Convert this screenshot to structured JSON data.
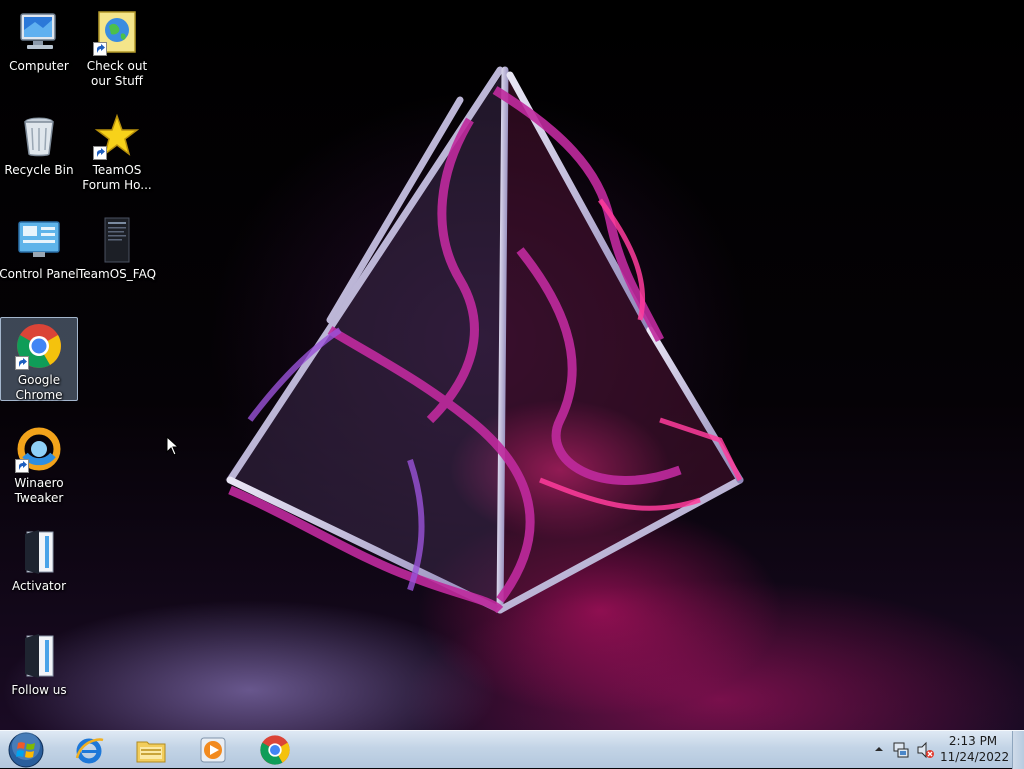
{
  "desktop": {
    "icons": [
      {
        "label": "Computer",
        "icon": "computer-icon",
        "shortcut": false
      },
      {
        "label": "Check out our Stuff",
        "icon": "globe-document-icon",
        "shortcut": true
      },
      {
        "label": "Recycle Bin",
        "icon": "recycle-bin-icon",
        "shortcut": false
      },
      {
        "label": "TeamOS Forum Ho...",
        "icon": "star-icon",
        "shortcut": true
      },
      {
        "label": "Control Panel",
        "icon": "control-panel-icon",
        "shortcut": false
      },
      {
        "label": "TeamOS_FAQ",
        "icon": "document-icon",
        "shortcut": false
      },
      {
        "label": "Google Chrome",
        "icon": "chrome-icon",
        "shortcut": true,
        "selected": true
      },
      {
        "label": "Winaero Tweaker",
        "icon": "winaero-icon",
        "shortcut": true
      },
      {
        "label": "Activator",
        "icon": "activator-icon",
        "shortcut": false
      },
      {
        "label": "Follow us",
        "icon": "follow-us-icon",
        "shortcut": false
      }
    ]
  },
  "taskbar": {
    "start": {
      "icon": "windows-orb-icon"
    },
    "pinned": [
      {
        "name": "Internet Explorer",
        "icon": "internet-explorer-icon"
      },
      {
        "name": "Windows Explorer",
        "icon": "folder-icon"
      },
      {
        "name": "Windows Media Player",
        "icon": "media-player-icon"
      },
      {
        "name": "Google Chrome",
        "icon": "chrome-icon"
      }
    ],
    "tray": {
      "icons": [
        "show-hidden-icons-arrow",
        "network-icon",
        "volume-muted-icon"
      ],
      "time": "2:13 PM",
      "date": "11/24/2022"
    }
  },
  "colors": {
    "wallpaper_magenta": "#e81478",
    "wallpaper_violet": "#8a3cc8",
    "taskbar": "#c3d4e6",
    "selection": "#aac8eb"
  }
}
